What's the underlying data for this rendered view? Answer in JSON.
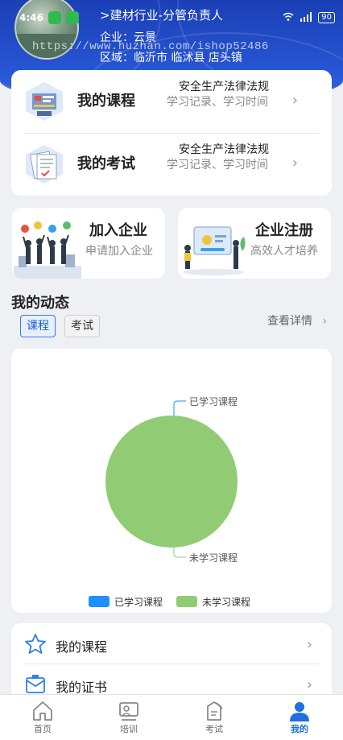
{
  "status_bar": {
    "time": "4:46",
    "battery": "90"
  },
  "header": {
    "role": ">建材行业-分管负责人",
    "company": "企业：云景",
    "region": "区域：临沂市 临沭县 店头镇",
    "watermark": "https://www.huzhan.com/ishop52486"
  },
  "course_card": {
    "rows": [
      {
        "title": "我的课程",
        "subtitle": "安全生产法律法规",
        "meta": "学习记录、学习时间"
      },
      {
        "title": "我的考试",
        "subtitle": "安全生产法律法规",
        "meta": "学习记录、学习时间"
      }
    ]
  },
  "quick_cards": {
    "join": {
      "title": "加入企业",
      "subtitle": "申请加入企业"
    },
    "register": {
      "title": "企业注册",
      "subtitle": "高效人才培养"
    }
  },
  "activity": {
    "title": "我的动态",
    "tabs": [
      "课程",
      "考试"
    ],
    "view_details": "查看详情"
  },
  "chart_data": {
    "type": "pie",
    "slices": [
      {
        "name": "已学习课程",
        "value": 0,
        "color": "#1e8fff"
      },
      {
        "name": "未学习课程",
        "value": 100,
        "color": "#91cc75"
      }
    ],
    "legend": [
      "已学习课程",
      "未学习课程"
    ],
    "legend_position": "bottom"
  },
  "menu": {
    "items": [
      {
        "label": "我的课程",
        "icon": "star-icon"
      },
      {
        "label": "我的证书",
        "icon": "certificate-icon"
      }
    ]
  },
  "tabbar": {
    "items": [
      {
        "label": "首页",
        "icon": "home-icon"
      },
      {
        "label": "培训",
        "icon": "training-icon"
      },
      {
        "label": "考试",
        "icon": "exam-icon"
      },
      {
        "label": "我的",
        "icon": "user-icon",
        "active": true
      }
    ]
  }
}
